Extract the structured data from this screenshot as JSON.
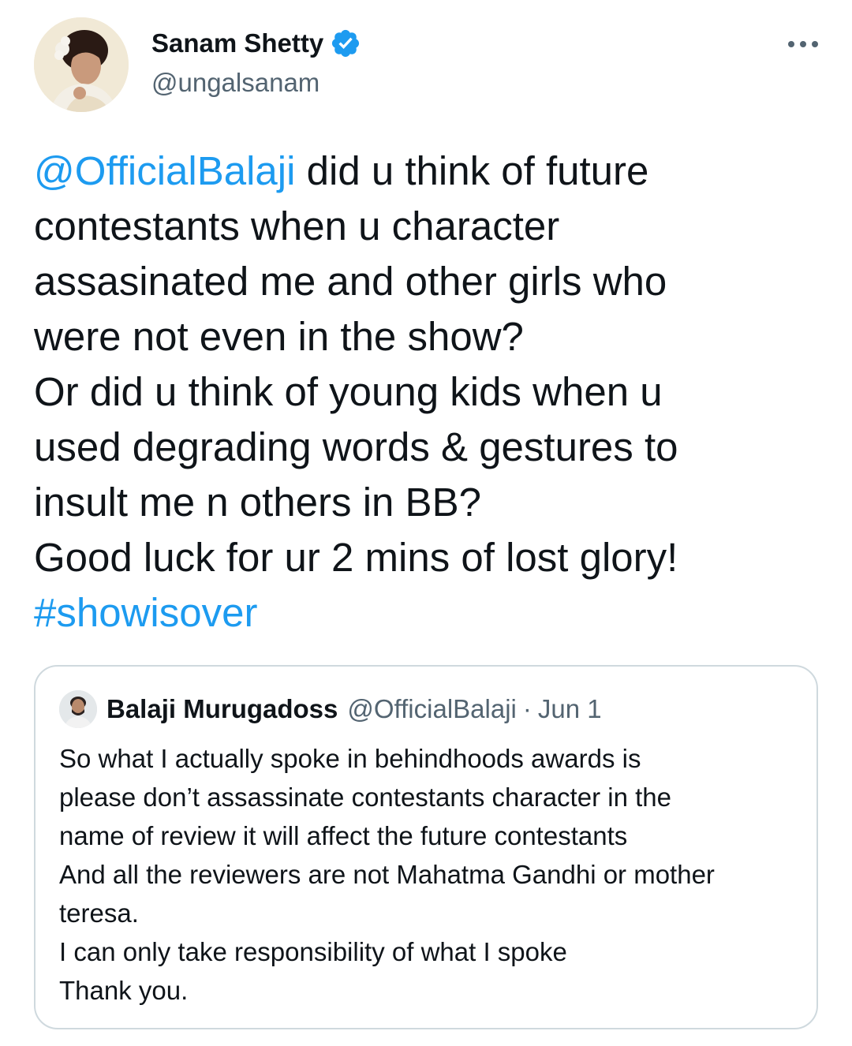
{
  "author": {
    "display_name": "Sanam Shetty",
    "handle": "@ungalsanam",
    "verified": true,
    "avatar_icon": "profile-photo"
  },
  "menu": {
    "icon": "more-options-icon"
  },
  "tweet": {
    "lines": [
      {
        "mention": "@OfficialBalaji",
        "text": " did u think of future"
      },
      {
        "text": "contestants when u character"
      },
      {
        "text": "assasinated me and other girls who"
      },
      {
        "text": "were not even in the show?"
      },
      {
        "text": "Or did u think of young kids when u"
      },
      {
        "text": "used degrading words & gestures to"
      },
      {
        "text": "insult me n others in BB?"
      },
      {
        "text": "Good luck for ur 2 mins of lost glory!"
      },
      {
        "hashtag": "#showisover"
      }
    ]
  },
  "quoted_tweet": {
    "display_name": "Balaji Murugadoss",
    "handle": "@OfficialBalaji",
    "separator": "·",
    "date": "Jun 1",
    "lines": [
      "So what I actually spoke in behindhoods awards is",
      "please don’t assassinate contestants character in the",
      "name of review it will affect the future contestants",
      "And all the reviewers are not Mahatma Gandhi or mother",
      "teresa.",
      "I can only take responsibility of what I spoke",
      "Thank you."
    ]
  },
  "colors": {
    "link": "#1d9bf0",
    "text": "#0f1419",
    "secondary": "#536471",
    "border": "#cfd9de"
  }
}
